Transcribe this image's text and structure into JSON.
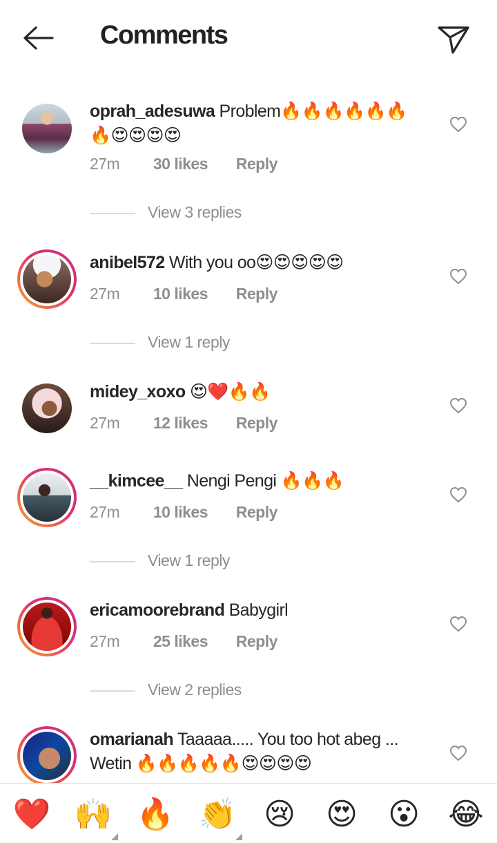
{
  "header": {
    "title": "Comments",
    "back_icon": "arrow-left-icon",
    "send_icon": "paper-plane-icon"
  },
  "comments": [
    {
      "username": "oprah_adesuwa",
      "text": "Problem🔥🔥🔥🔥🔥🔥🔥😍😍😍😍",
      "time": "27m",
      "likes": "30 likes",
      "reply": "Reply",
      "view_replies": "View 3 replies",
      "avatar_ring": false
    },
    {
      "username": "anibel572",
      "text": "With you oo😍😍😍😍😍",
      "time": "27m",
      "likes": "10 likes",
      "reply": "Reply",
      "view_replies": "View 1 reply",
      "avatar_ring": true
    },
    {
      "username": "midey_xoxo",
      "text": "😍❤️🔥🔥",
      "time": "27m",
      "likes": "12 likes",
      "reply": "Reply",
      "view_replies": "",
      "avatar_ring": false
    },
    {
      "username": "__kimcee__",
      "text": "Nengi Pengi 🔥🔥🔥",
      "time": "27m",
      "likes": "10 likes",
      "reply": "Reply",
      "view_replies": "View 1 reply",
      "avatar_ring": true
    },
    {
      "username": "ericamoorebrand",
      "text": "Babygirl",
      "time": "27m",
      "likes": "25 likes",
      "reply": "Reply",
      "view_replies": "View 2 replies",
      "avatar_ring": true
    },
    {
      "username": "omarianah",
      "text": "Taaaaa..... You too hot abeg ... Wetin 🔥🔥🔥🔥🔥😍😍😍😍",
      "time": "",
      "likes": "",
      "reply": "",
      "view_replies": "",
      "avatar_ring": true
    }
  ],
  "reactions": [
    "❤️",
    "🙌",
    "🔥",
    "👏",
    "😢",
    "😍",
    "😮",
    "😂"
  ],
  "colors": {
    "text": "#262626",
    "muted": "#8e8e8e",
    "divider": "#dbdbdb",
    "story_ring_start": "#f9a825",
    "story_ring_end": "#c13584"
  }
}
